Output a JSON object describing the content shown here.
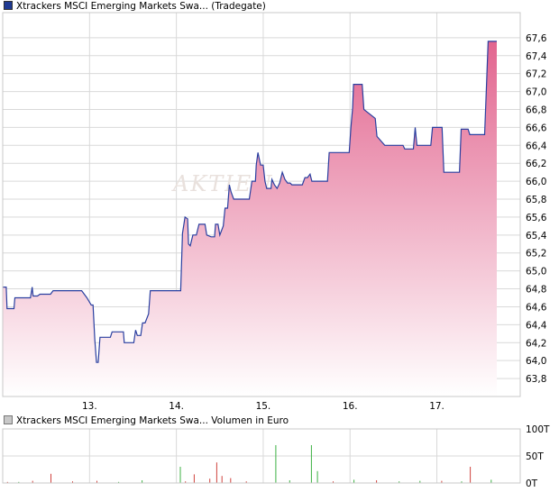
{
  "price_legend": "Xtrackers MSCI Emerging Markets Swa... (Tradegate)",
  "volume_legend": "Xtrackers MSCI Emerging Markets Swa... Volumen in Euro",
  "watermark": "AKTIEN",
  "colors": {
    "line": "#2a3fa0",
    "fill_top": "#e2658f",
    "fill_bottom": "#ffffff",
    "vol_up": "#3cb043",
    "vol_down": "#d0433e",
    "grid": "#d9d9d9"
  },
  "chart_data": [
    {
      "type": "area",
      "title": "Xtrackers MSCI Emerging Markets Swa... (Tradegate)",
      "x_ticks": [
        {
          "label": "13.",
          "x": 1
        },
        {
          "label": "14.",
          "x": 2
        },
        {
          "label": "15.",
          "x": 3
        },
        {
          "label": "16.",
          "x": 4
        },
        {
          "label": "17.",
          "x": 5
        }
      ],
      "xlim": [
        0.0,
        5.69
      ],
      "ylim": [
        63.6,
        67.88
      ],
      "y_ticks": [
        "63,8",
        "64,0",
        "64,2",
        "64,4",
        "64,6",
        "64,8",
        "65,0",
        "65,2",
        "65,4",
        "65,6",
        "65,8",
        "66,0",
        "66,2",
        "66,4",
        "66,6",
        "66,8",
        "67,0",
        "67,2",
        "67,4",
        "67,6"
      ],
      "y_tick_values": [
        63.8,
        64.0,
        64.2,
        64.4,
        64.6,
        64.8,
        65.0,
        65.2,
        65.4,
        65.6,
        65.8,
        66.0,
        66.2,
        66.4,
        66.6,
        66.8,
        67.0,
        67.2,
        67.4,
        67.6
      ],
      "series": [
        {
          "points": [
            [
              0.0,
              64.82
            ],
            [
              0.04,
              64.82
            ],
            [
              0.05,
              64.58
            ],
            [
              0.13,
              64.58
            ],
            [
              0.14,
              64.7
            ],
            [
              0.32,
              64.7
            ],
            [
              0.34,
              64.82
            ],
            [
              0.35,
              64.72
            ],
            [
              0.4,
              64.72
            ],
            [
              0.43,
              64.74
            ],
            [
              0.55,
              64.74
            ],
            [
              0.58,
              64.78
            ],
            [
              0.91,
              64.78
            ],
            [
              0.97,
              64.7
            ],
            [
              1.02,
              64.62
            ],
            [
              1.04,
              64.62
            ],
            [
              1.06,
              64.24
            ],
            [
              1.08,
              63.98
            ],
            [
              1.1,
              63.98
            ],
            [
              1.12,
              64.26
            ],
            [
              1.24,
              64.26
            ],
            [
              1.26,
              64.32
            ],
            [
              1.39,
              64.32
            ],
            [
              1.4,
              64.2
            ],
            [
              1.51,
              64.2
            ],
            [
              1.53,
              64.34
            ],
            [
              1.55,
              64.28
            ],
            [
              1.59,
              64.28
            ],
            [
              1.61,
              64.42
            ],
            [
              1.64,
              64.42
            ],
            [
              1.68,
              64.52
            ],
            [
              1.7,
              64.78
            ],
            [
              2.05,
              64.78
            ],
            [
              2.07,
              65.42
            ],
            [
              2.1,
              65.6
            ],
            [
              2.13,
              65.58
            ],
            [
              2.14,
              65.3
            ],
            [
              2.16,
              65.28
            ],
            [
              2.19,
              65.4
            ],
            [
              2.23,
              65.4
            ],
            [
              2.26,
              65.52
            ],
            [
              2.33,
              65.52
            ],
            [
              2.35,
              65.4
            ],
            [
              2.4,
              65.38
            ],
            [
              2.44,
              65.38
            ],
            [
              2.45,
              65.52
            ],
            [
              2.48,
              65.52
            ],
            [
              2.5,
              65.4
            ],
            [
              2.54,
              65.5
            ],
            [
              2.56,
              65.7
            ],
            [
              2.59,
              65.7
            ],
            [
              2.61,
              65.96
            ],
            [
              2.63,
              65.88
            ],
            [
              2.66,
              65.8
            ],
            [
              2.84,
              65.8
            ],
            [
              2.87,
              66.0
            ],
            [
              2.91,
              66.0
            ],
            [
              2.92,
              66.18
            ],
            [
              2.94,
              66.32
            ],
            [
              2.97,
              66.18
            ],
            [
              3.0,
              66.18
            ],
            [
              3.02,
              66.0
            ],
            [
              3.04,
              65.92
            ],
            [
              3.09,
              65.92
            ],
            [
              3.1,
              66.02
            ],
            [
              3.13,
              65.96
            ],
            [
              3.16,
              65.92
            ],
            [
              3.19,
              65.98
            ],
            [
              3.22,
              66.1
            ],
            [
              3.25,
              66.02
            ],
            [
              3.28,
              65.98
            ],
            [
              3.31,
              65.98
            ],
            [
              3.33,
              65.96
            ],
            [
              3.45,
              65.96
            ],
            [
              3.48,
              66.04
            ],
            [
              3.51,
              66.04
            ],
            [
              3.54,
              66.08
            ],
            [
              3.56,
              66.0
            ],
            [
              3.74,
              66.0
            ],
            [
              3.76,
              66.32
            ],
            [
              3.99,
              66.32
            ],
            [
              4.01,
              66.6
            ],
            [
              4.03,
              66.82
            ],
            [
              4.04,
              67.08
            ],
            [
              4.14,
              67.08
            ],
            [
              4.16,
              66.8
            ],
            [
              4.29,
              66.7
            ],
            [
              4.31,
              66.5
            ],
            [
              4.4,
              66.4
            ],
            [
              4.61,
              66.4
            ],
            [
              4.63,
              66.36
            ],
            [
              4.73,
              66.36
            ],
            [
              4.75,
              66.6
            ],
            [
              4.77,
              66.4
            ],
            [
              4.93,
              66.4
            ],
            [
              4.95,
              66.6
            ],
            [
              5.06,
              66.6
            ],
            [
              5.08,
              66.1
            ],
            [
              5.26,
              66.1
            ],
            [
              5.28,
              66.58
            ],
            [
              5.36,
              66.58
            ],
            [
              5.38,
              66.52
            ],
            [
              5.55,
              66.52
            ],
            [
              5.57,
              67.02
            ],
            [
              5.59,
              67.56
            ],
            [
              5.69,
              67.56
            ]
          ]
        }
      ]
    },
    {
      "type": "bar",
      "title": "Xtrackers MSCI Emerging Markets Swa... Volumen in Euro",
      "ylim": [
        0,
        100
      ],
      "y_ticks": [
        "0T",
        "50T",
        "100T"
      ],
      "y_tick_values": [
        0,
        50,
        100
      ],
      "bars": [
        {
          "x": 0.05,
          "v": 2,
          "c": "down"
        },
        {
          "x": 0.18,
          "v": 2,
          "c": "up"
        },
        {
          "x": 0.34,
          "v": 4,
          "c": "down"
        },
        {
          "x": 0.55,
          "v": 17,
          "c": "down"
        },
        {
          "x": 0.8,
          "v": 3,
          "c": "down"
        },
        {
          "x": 1.08,
          "v": 4,
          "c": "down"
        },
        {
          "x": 1.33,
          "v": 2,
          "c": "up"
        },
        {
          "x": 1.6,
          "v": 5,
          "c": "up"
        },
        {
          "x": 2.04,
          "v": 30,
          "c": "up"
        },
        {
          "x": 2.1,
          "v": 3,
          "c": "down"
        },
        {
          "x": 2.2,
          "v": 16,
          "c": "down"
        },
        {
          "x": 2.38,
          "v": 8,
          "c": "down"
        },
        {
          "x": 2.46,
          "v": 38,
          "c": "down"
        },
        {
          "x": 2.52,
          "v": 13,
          "c": "down"
        },
        {
          "x": 2.62,
          "v": 9,
          "c": "down"
        },
        {
          "x": 2.8,
          "v": 3,
          "c": "down"
        },
        {
          "x": 3.14,
          "v": 70,
          "c": "up"
        },
        {
          "x": 3.3,
          "v": 5,
          "c": "up"
        },
        {
          "x": 3.55,
          "v": 70,
          "c": "up"
        },
        {
          "x": 3.62,
          "v": 22,
          "c": "up"
        },
        {
          "x": 3.8,
          "v": 3,
          "c": "down"
        },
        {
          "x": 4.04,
          "v": 6,
          "c": "up"
        },
        {
          "x": 4.3,
          "v": 5,
          "c": "down"
        },
        {
          "x": 4.56,
          "v": 3,
          "c": "up"
        },
        {
          "x": 4.8,
          "v": 4,
          "c": "up"
        },
        {
          "x": 5.05,
          "v": 4,
          "c": "down"
        },
        {
          "x": 5.28,
          "v": 3,
          "c": "up"
        },
        {
          "x": 5.38,
          "v": 30,
          "c": "down"
        },
        {
          "x": 5.62,
          "v": 6,
          "c": "up"
        }
      ]
    }
  ]
}
